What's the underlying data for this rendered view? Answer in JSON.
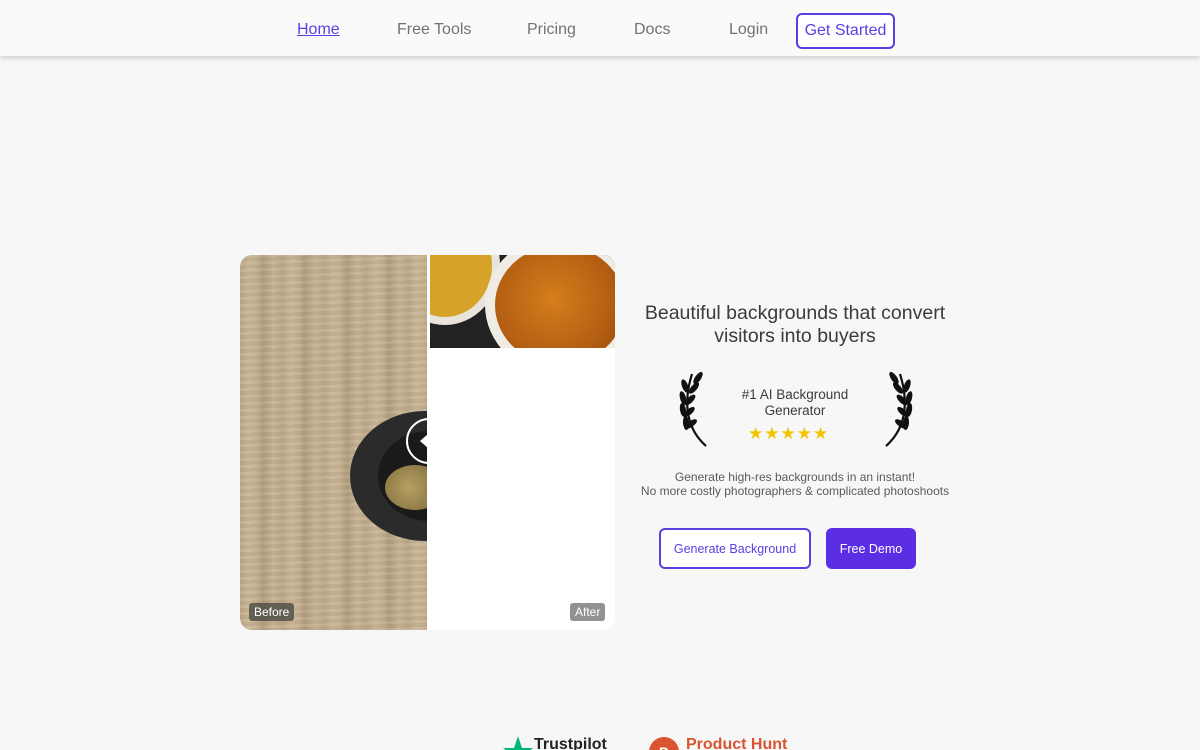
{
  "nav": {
    "links": [
      "Home",
      "Free Tools",
      "Pricing",
      "Docs",
      "Login"
    ],
    "cta": "Get Started"
  },
  "compare": {
    "before_label": "Before",
    "after_label": "After"
  },
  "hero": {
    "title": "Beautiful backgrounds that convert visitors into buyers",
    "award": "#1 AI Background Generator",
    "rating_stars": "★★★★★",
    "description_line1": "Generate high-res backgrounds in an instant!",
    "description_line2": "No more costly photographers & complicated photoshoots",
    "primary_button": "Generate Background",
    "secondary_button": "Free Demo"
  },
  "partners": {
    "trustpilot": "Trustpilot",
    "producthunt": "Product Hunt"
  },
  "colors": {
    "accent": "#5b3ee0",
    "star": "#f5c200"
  }
}
